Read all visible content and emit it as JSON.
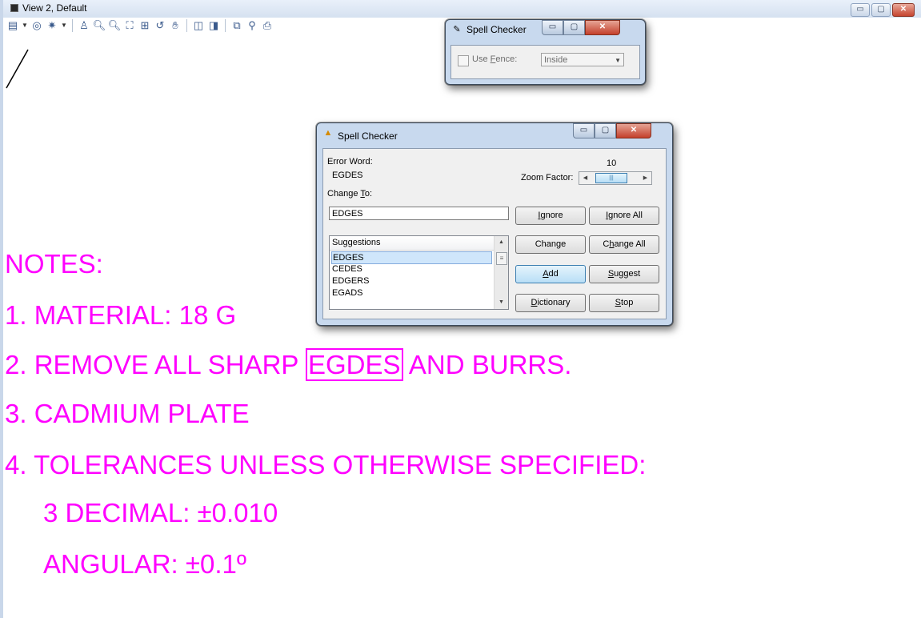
{
  "view_window": {
    "title": "View 2, Default",
    "controls": {
      "minimize": "▭",
      "maximize": "▢",
      "close": "✕"
    },
    "toolbar_icons": [
      "view-display-icon",
      "dropdown-arrow-icon",
      "view-attributes-icon",
      "dropdown-arrow-icon",
      "lighting-icon",
      "dropdown-arrow-icon",
      "update-view-icon",
      "zoom-in-icon",
      "zoom-out-icon",
      "window-area-icon",
      "fit-view-icon",
      "rotate-view-icon",
      "pan-view-icon",
      "view-previous-icon",
      "view-next-icon",
      "copy-view-icon",
      "camera-icon",
      "save-view-icon"
    ]
  },
  "drawing": {
    "color": "#ff00ff",
    "lines": [
      "NOTES:",
      "1. MATERIAL: 18 G",
      "2. REMOVE ALL SHARP ",
      "3. CADMIUM PLATE",
      "4. TOLERANCES UNLESS OTHERWISE SPECIFIED:",
      "3 DECIMAL: ±0.010",
      "ANGULAR: ±0.1º"
    ],
    "highlight_word": "EGDES",
    "line2_suffix": " AND BURRS."
  },
  "fence_dialog": {
    "title": "Spell Checker",
    "use_fence_label_pre": "Use ",
    "use_fence_label_u": "F",
    "use_fence_label_post": "ence:",
    "use_fence_checked": false,
    "fence_mode": "Inside"
  },
  "spell_dialog": {
    "title": "Spell Checker",
    "error_word_label": "Error Word:",
    "error_word": "EGDES",
    "zoom_value": "10",
    "zoom_factor_label": "Zoom Factor:",
    "change_to_label_pre": "Change ",
    "change_to_label_u": "T",
    "change_to_label_post": "o:",
    "change_to_value": "EDGES",
    "suggestions_header": "Suggestions",
    "suggestions": [
      "EDGES",
      "CEDES",
      "EDGERS",
      "EGADS"
    ],
    "buttons": {
      "ignore": {
        "pre": "",
        "u": "I",
        "post": "gnore"
      },
      "ignore_all": {
        "pre": "",
        "u": "I",
        "post": "gnore All"
      },
      "change": {
        "pre": "Change",
        "u": "",
        "post": ""
      },
      "change_all": {
        "pre": "C",
        "u": "h",
        "post": "ange All"
      },
      "add": {
        "pre": "",
        "u": "A",
        "post": "dd"
      },
      "suggest": {
        "pre": "",
        "u": "S",
        "post": "uggest"
      },
      "dictionary": {
        "pre": "",
        "u": "D",
        "post": "ictionary"
      },
      "stop": {
        "pre": "",
        "u": "S",
        "post": "top"
      }
    }
  }
}
